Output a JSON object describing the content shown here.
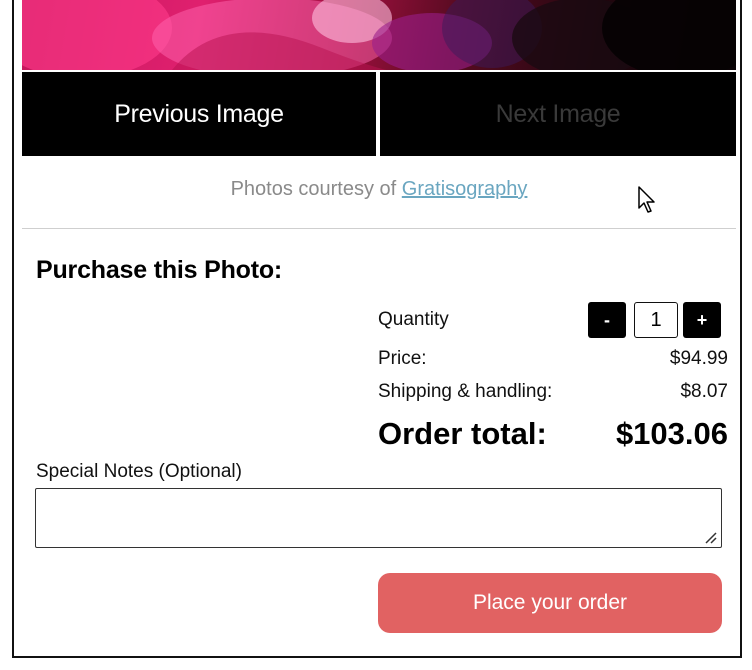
{
  "gallery": {
    "previous_label": "Previous Image",
    "next_label": "Next Image",
    "credit_prefix": "Photos courtesy of",
    "credit_link": "Gratisography"
  },
  "purchase": {
    "title": "Purchase this Photo:",
    "quantity_label": "Quantity",
    "quantity_minus": "-",
    "quantity_value": "1",
    "quantity_plus": "+",
    "price_label": "Price:",
    "price_value": "$94.99",
    "shipping_label": "Shipping & handling:",
    "shipping_value": "$8.07",
    "total_label": "Order total:",
    "total_value": "$103.06"
  },
  "notes": {
    "label": "Special Notes (Optional)",
    "value": ""
  },
  "actions": {
    "order_label": "Place your order"
  },
  "colors": {
    "order_button": "#e16262",
    "nav_button": "#000000",
    "link": "#6aa6c0"
  }
}
